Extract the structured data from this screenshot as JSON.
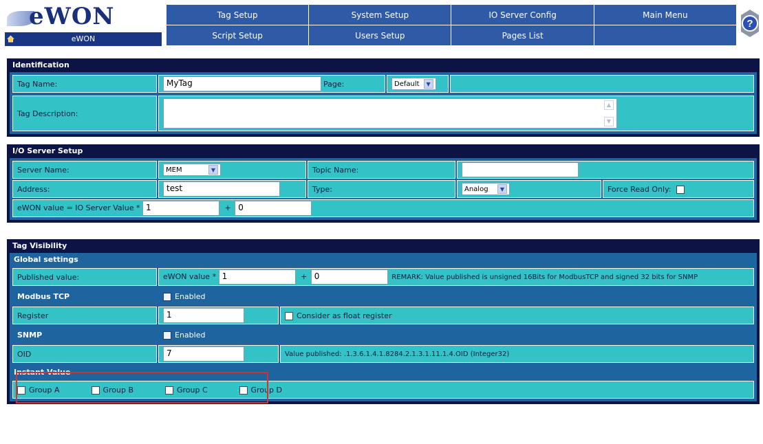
{
  "app": {
    "logo": "eWON",
    "home_label": "eWON"
  },
  "menu": {
    "row1": [
      "Tag Setup",
      "System Setup",
      "IO Server Config",
      "Main Menu"
    ],
    "row2": [
      "Script Setup",
      "Users Setup",
      "Pages List",
      ""
    ]
  },
  "identification": {
    "title": "Identification",
    "tag_name_label": "Tag Name:",
    "tag_name_value": "MyTag",
    "page_label": "Page:",
    "page_value": "Default",
    "description_label": "Tag Description:",
    "description_value": ""
  },
  "io_server": {
    "title": "I/O Server Setup",
    "server_name_label": "Server Name:",
    "server_name_value": "MEM",
    "topic_name_label": "Topic Name:",
    "topic_name_value": "",
    "address_label": "Address:",
    "address_value": "test",
    "type_label": "Type:",
    "type_value": "Analog",
    "force_read_only_label": "Force Read Only:",
    "force_read_only_checked": false,
    "formula_label": "eWON value = IO Server Value *",
    "scale_value": "1",
    "plus": "+",
    "offset_value": "0"
  },
  "visibility": {
    "title": "Tag Visibility",
    "global_settings": "Global settings",
    "published_label": "Published value:",
    "published_prefix": "eWON value *",
    "published_scale": "1",
    "plus": "+",
    "published_offset": "0",
    "remark": "REMARK: Value published is unsigned 16Bits for ModbusTCP and signed 32 bits for SNMP",
    "modbus_title": "Modbus TCP",
    "enabled_label": "Enabled",
    "modbus_enabled": true,
    "register_label": "Register",
    "register_value": "1",
    "float_label": "Consider as float register",
    "float_checked": false,
    "snmp_title": "SNMP",
    "snmp_enabled": true,
    "oid_label": "OID",
    "oid_value": "7",
    "oid_published": "Value published: .1.3.6.1.4.1.8284.2.1.3.1.11.1.4.OID (Integer32)",
    "instant_title": "Instant Value",
    "groups": [
      "Group A",
      "Group B",
      "Group C",
      "Group D"
    ]
  },
  "colors": {
    "navy": "#0c1446",
    "teal": "#33c3c6",
    "blue": "#1e65a0",
    "menu": "#2f5aa5",
    "highlight": "#d4312f"
  }
}
